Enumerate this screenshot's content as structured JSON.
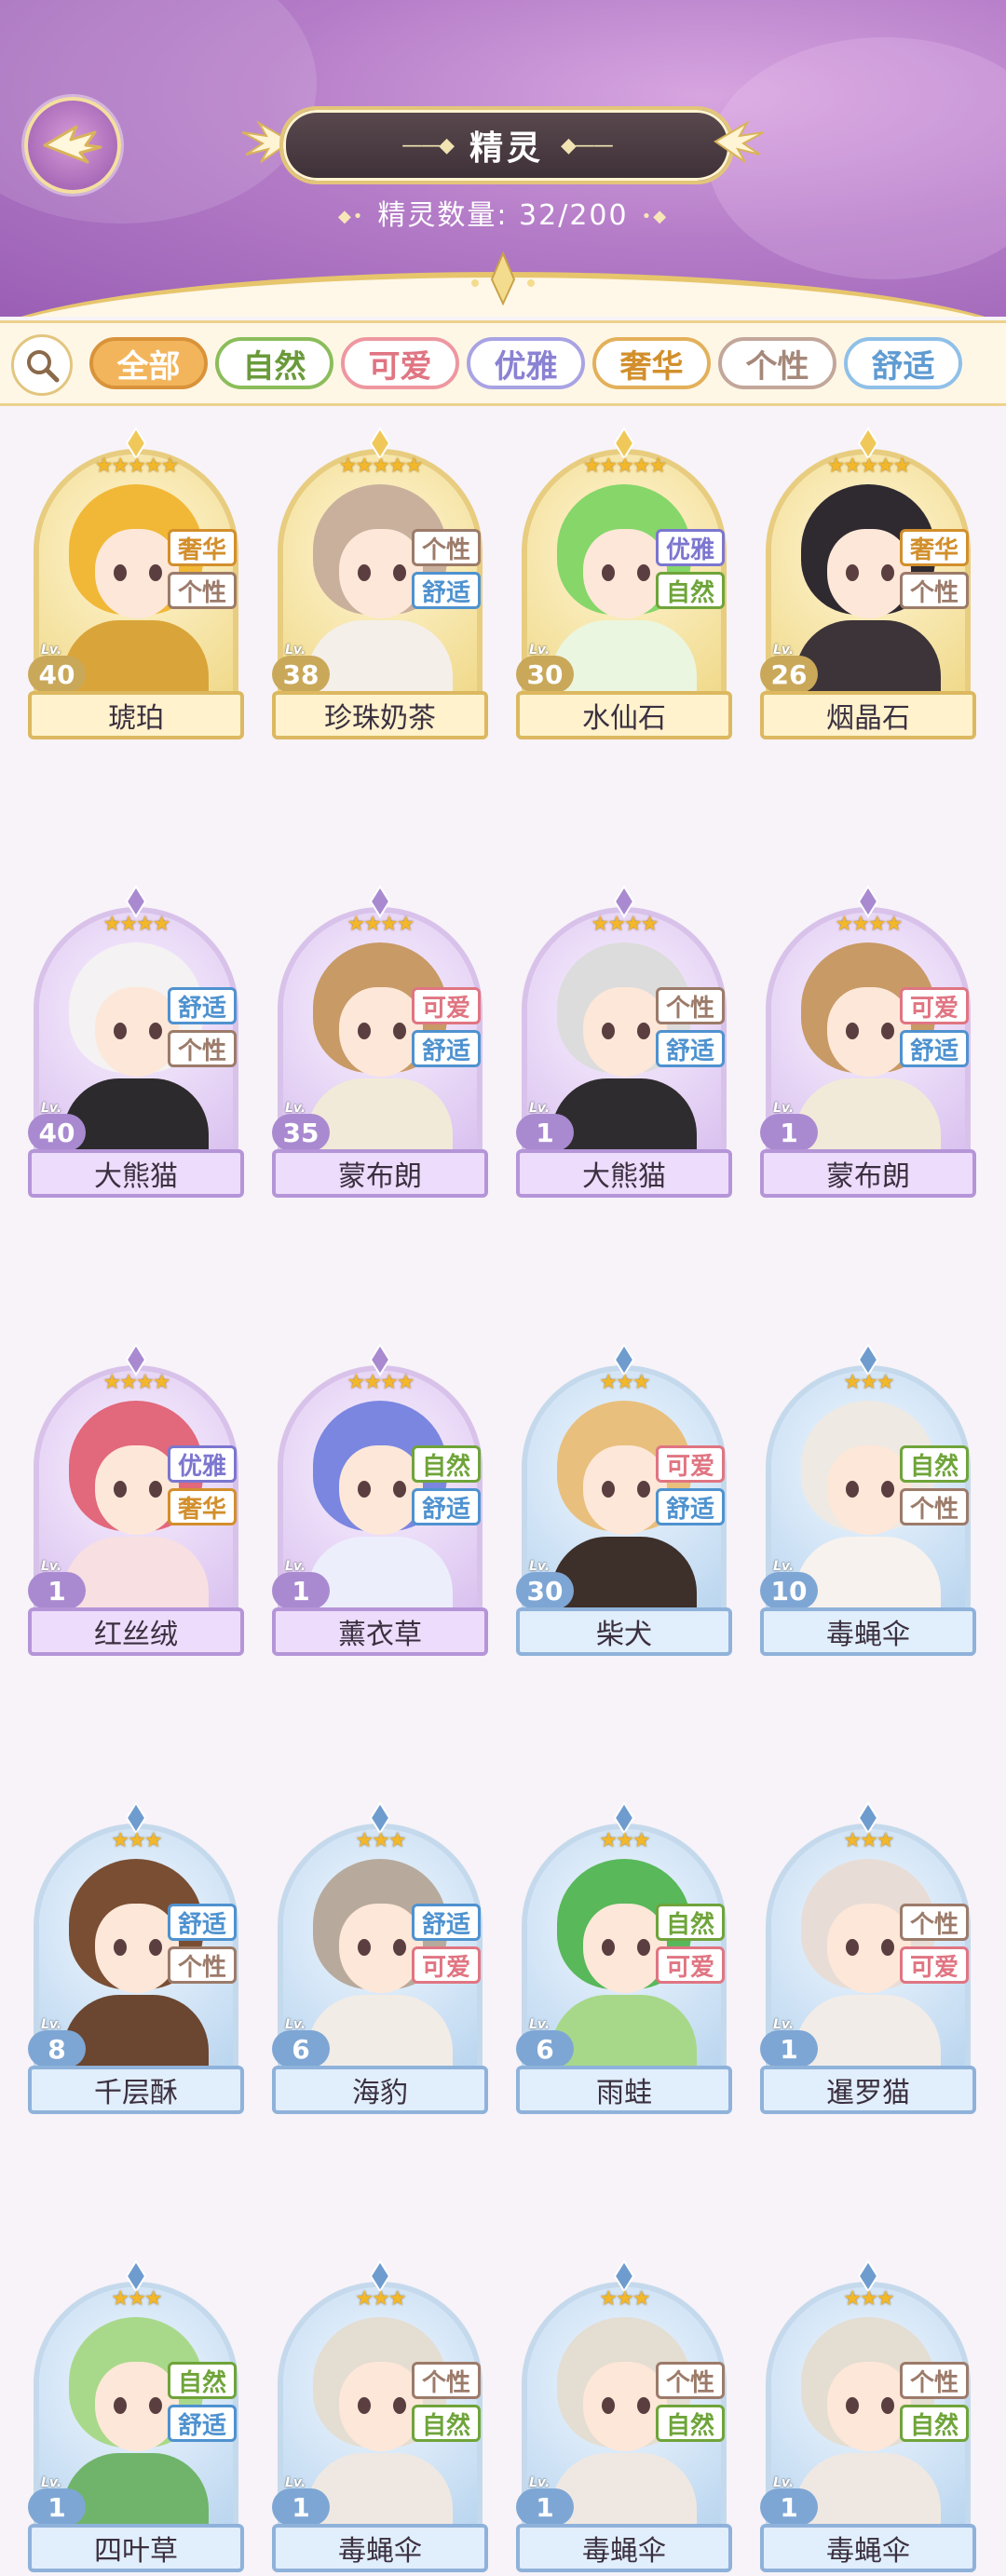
{
  "header": {
    "title": "精灵",
    "count_label": "精灵数量: 32/200",
    "back_icon": "wing-back-icon"
  },
  "filters": {
    "search_icon": "search-icon",
    "tabs": [
      {
        "label": "全部",
        "color": "#d9933a",
        "bg": "#f3b55c",
        "text": "#ffffff",
        "active": true
      },
      {
        "label": "自然",
        "color": "#8bbd5b",
        "bg": "#ffffff",
        "text": "#6a9a3a"
      },
      {
        "label": "可爱",
        "color": "#ee97a0",
        "bg": "#ffffff",
        "text": "#e07582"
      },
      {
        "label": "优雅",
        "color": "#a8a3e3",
        "bg": "#ffffff",
        "text": "#8a82d3"
      },
      {
        "label": "奢华",
        "color": "#e3b05a",
        "bg": "#ffffff",
        "text": "#d28f2c"
      },
      {
        "label": "个性",
        "color": "#c2a79a",
        "bg": "#ffffff",
        "text": "#a5887a"
      },
      {
        "label": "舒适",
        "color": "#8fc0e8",
        "bg": "#ffffff",
        "text": "#5f9bd2"
      }
    ]
  },
  "tag_colors": {
    "自然": "#6fa43a",
    "可爱": "#e07582",
    "优雅": "#7c76cf",
    "奢华": "#d28f2c",
    "个性": "#9c7b6a",
    "舒适": "#4f92cf"
  },
  "spirits": [
    {
      "name": "琥珀",
      "level": "40",
      "stars": 5,
      "tags": [
        "奢华",
        "个性"
      ],
      "hair": "#f1b736",
      "outfit": "#d9a53a"
    },
    {
      "name": "珍珠奶茶",
      "level": "38",
      "stars": 5,
      "tags": [
        "个性",
        "舒适"
      ],
      "hair": "#c9b09c",
      "outfit": "#f4efe9"
    },
    {
      "name": "水仙石",
      "level": "30",
      "stars": 5,
      "tags": [
        "优雅",
        "自然"
      ],
      "hair": "#86d66a",
      "outfit": "#eaf6df"
    },
    {
      "name": "烟晶石",
      "level": "26",
      "stars": 5,
      "tags": [
        "奢华",
        "个性"
      ],
      "hair": "#2f2a30",
      "outfit": "#3c3438"
    },
    {
      "name": "大熊猫",
      "level": "40",
      "stars": 4,
      "tags": [
        "舒适",
        "个性"
      ],
      "hair": "#f4f2f2",
      "outfit": "#2c2a2c"
    },
    {
      "name": "蒙布朗",
      "level": "35",
      "stars": 4,
      "tags": [
        "可爱",
        "舒适"
      ],
      "hair": "#c89a66",
      "outfit": "#f2ead8"
    },
    {
      "name": "大熊猫",
      "level": "1",
      "stars": 4,
      "tags": [
        "个性",
        "舒适"
      ],
      "hair": "#dcdcdc",
      "outfit": "#2f2c2f"
    },
    {
      "name": "蒙布朗",
      "level": "1",
      "stars": 4,
      "tags": [
        "可爱",
        "舒适"
      ],
      "hair": "#c89a66",
      "outfit": "#f2ead8"
    },
    {
      "name": "红丝绒",
      "level": "1",
      "stars": 4,
      "tags": [
        "优雅",
        "奢华"
      ],
      "hair": "#e2687b",
      "outfit": "#f7dfe2"
    },
    {
      "name": "薰衣草",
      "level": "1",
      "stars": 4,
      "tags": [
        "自然",
        "舒适"
      ],
      "hair": "#7a86e0",
      "outfit": "#eceefc"
    },
    {
      "name": "柴犬",
      "level": "30",
      "stars": 3,
      "tags": [
        "可爱",
        "舒适"
      ],
      "hair": "#e8bf7c",
      "outfit": "#3d2f2a"
    },
    {
      "name": "毒蝇伞",
      "level": "10",
      "stars": 3,
      "tags": [
        "自然",
        "个性"
      ],
      "hair": "#efe9e3",
      "outfit": "#f7f2ee"
    },
    {
      "name": "千层酥",
      "level": "8",
      "stars": 3,
      "tags": [
        "舒适",
        "个性"
      ],
      "hair": "#7a4e33",
      "outfit": "#6b4630"
    },
    {
      "name": "海豹",
      "level": "6",
      "stars": 3,
      "tags": [
        "舒适",
        "可爱"
      ],
      "hair": "#b7aa9c",
      "outfit": "#f1ece6"
    },
    {
      "name": "雨蛙",
      "level": "6",
      "stars": 3,
      "tags": [
        "自然",
        "可爱"
      ],
      "hair": "#58b85a",
      "outfit": "#a7d88a"
    },
    {
      "name": "暹罗猫",
      "level": "1",
      "stars": 3,
      "tags": [
        "个性",
        "可爱"
      ],
      "hair": "#e8ddd6",
      "outfit": "#f2ece8"
    },
    {
      "name": "四叶草",
      "level": "1",
      "stars": 3,
      "tags": [
        "自然",
        "舒适"
      ],
      "hair": "#a8d98a",
      "outfit": "#6fb46a"
    },
    {
      "name": "毒蝇伞",
      "level": "1",
      "stars": 3,
      "tags": [
        "个性",
        "自然"
      ],
      "hair": "#e4ddd2",
      "outfit": "#efe8e2"
    },
    {
      "name": "毒蝇伞",
      "level": "1",
      "stars": 3,
      "tags": [
        "个性",
        "自然"
      ],
      "hair": "#e4ddd2",
      "outfit": "#efe8e2"
    },
    {
      "name": "毒蝇伞",
      "level": "1",
      "stars": 3,
      "tags": [
        "个性",
        "自然"
      ],
      "hair": "#e4ddd2",
      "outfit": "#efe8e2"
    }
  ]
}
